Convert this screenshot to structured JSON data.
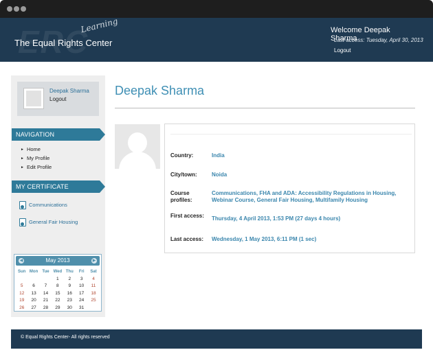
{
  "header": {
    "logo_watermark": "ERC",
    "logo_script": "Learning",
    "logo_text": "The Equal Rights Center",
    "welcome": "Welcome Deepak Sharma",
    "last_access": "Last access: Tuesday, April 30, 2013",
    "logout": "Logout"
  },
  "sidebar": {
    "profile": {
      "name": "Deepak Sharma",
      "logout": "Logout"
    },
    "navigation": {
      "title": "NAVIGATION",
      "items": [
        "Home",
        "My Profile",
        "Edit Profile"
      ]
    },
    "certificate": {
      "title": "MY CERTIFICATE",
      "items": [
        "Communications",
        "General Fair Housing"
      ]
    },
    "calendar": {
      "month": "May 2013",
      "prev": "◀",
      "next": "▶",
      "days_of_week": [
        "Sun",
        "Mon",
        "Tue",
        "Wed",
        "Thu",
        "Fri",
        "Sat"
      ],
      "weeks": [
        [
          "",
          "",
          "",
          "1",
          "2",
          "3",
          "4"
        ],
        [
          "5",
          "6",
          "7",
          "8",
          "9",
          "10",
          "11"
        ],
        [
          "12",
          "13",
          "14",
          "15",
          "16",
          "17",
          "18"
        ],
        [
          "19",
          "20",
          "21",
          "22",
          "23",
          "24",
          "25"
        ],
        [
          "26",
          "27",
          "28",
          "29",
          "30",
          "31",
          ""
        ]
      ]
    }
  },
  "main": {
    "title": "Deepak Sharma",
    "details": [
      {
        "label": "Country:",
        "value": "India"
      },
      {
        "label": "City/town:",
        "value": "Noida"
      },
      {
        "label": "Course profiles:",
        "value": "Communications, FHA and ADA: Accessibility Regulations in Housing, Webinar Course, General Fair Housing, Multifamily Housing"
      },
      {
        "label": "First access:",
        "value": "Thursday, 4 April 2013, 1:53 PM  (27 days 4 hours)"
      },
      {
        "label": "Last access:",
        "value": "Wednesday, 1 May 2013, 6:11 PM  (1 sec)"
      }
    ]
  },
  "footer": {
    "text": "© Equal Rights Center- All rights reserved"
  },
  "colors": {
    "header_bg": "#1f3a52",
    "accent": "#2e7a99",
    "link": "#3a86ad",
    "title": "#3f8fb4"
  }
}
